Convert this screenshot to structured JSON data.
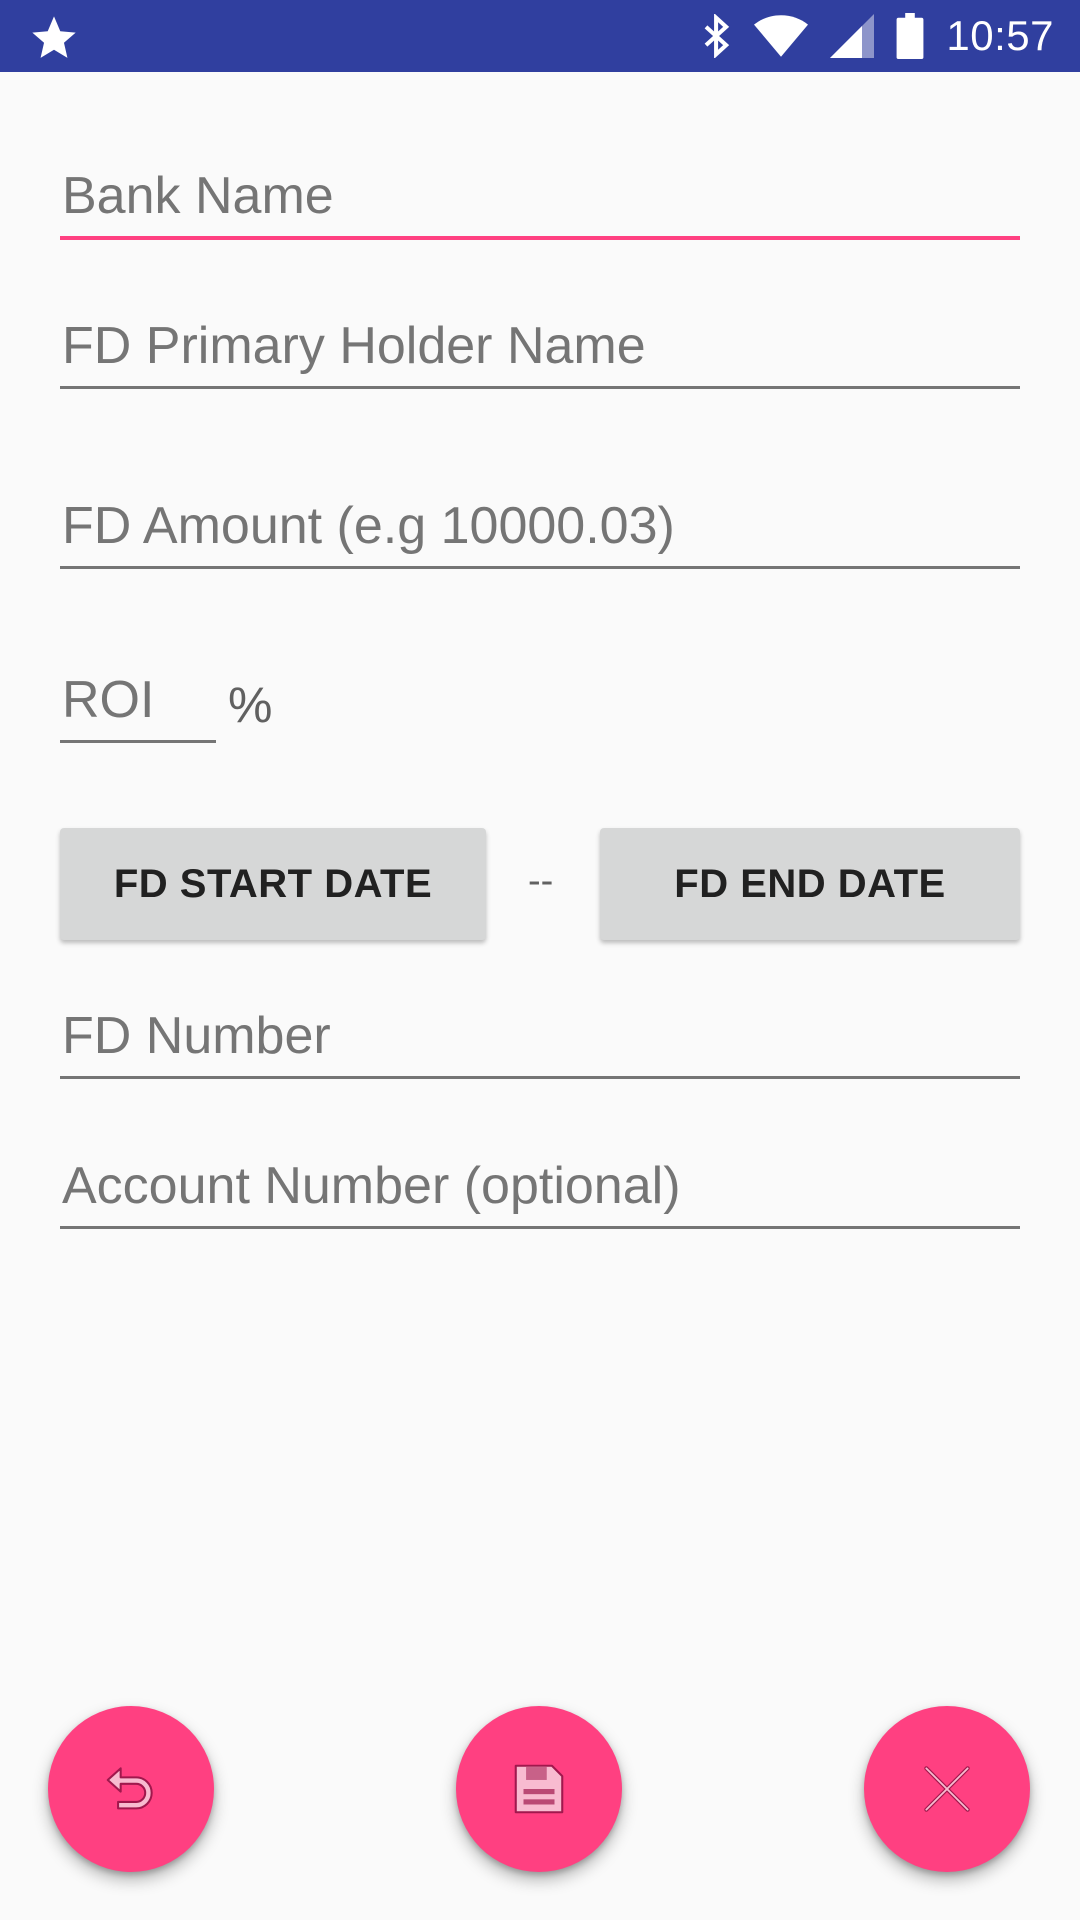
{
  "status_bar": {
    "time": "10:57",
    "icons": [
      "star-icon",
      "bluetooth-icon",
      "wifi-icon",
      "signal-icon",
      "battery-icon"
    ]
  },
  "form": {
    "bank_name_placeholder": "Bank Name",
    "holder_name_placeholder": "FD Primary Holder Name",
    "amount_placeholder": "FD Amount (e.g 10000.03)",
    "roi_placeholder": "ROI",
    "roi_suffix": "%",
    "start_date_label": "FD START DATE",
    "date_separator": "--",
    "end_date_label": "FD END DATE",
    "fd_number_placeholder": "FD Number",
    "account_number_placeholder": "Account Number (optional)"
  },
  "fabs": {
    "undo_icon": "undo-icon",
    "save_icon": "save-icon",
    "close_icon": "close-icon"
  },
  "colors": {
    "status_bar": "#303f9f",
    "accent": "#ff4081",
    "button_bg": "#d6d7d7",
    "background": "#fafafa"
  }
}
